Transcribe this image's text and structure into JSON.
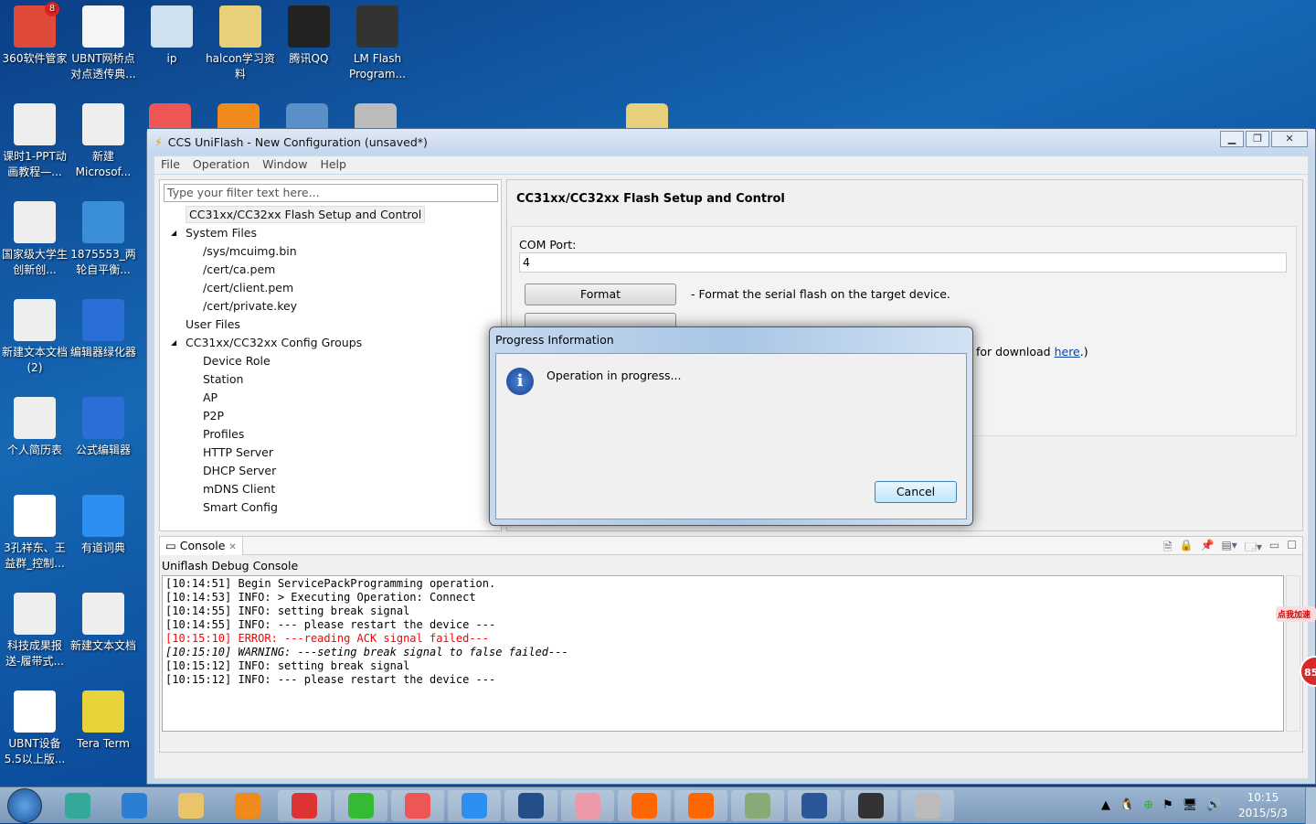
{
  "desktop_icons": [
    {
      "label": "360软件管家",
      "badge": "8",
      "color": "#e04a3a"
    },
    {
      "label": "UBNT网桥点对点透传典...",
      "color": "#f5f5f5"
    },
    {
      "label": "ip",
      "color": "#cfe0f0"
    },
    {
      "label": "halcon学习资料",
      "color": "#e8cf7a"
    },
    {
      "label": "腾讯QQ",
      "color": "#222"
    },
    {
      "label": "LM Flash Program...",
      "color": "#333"
    },
    {
      "label": "课时1-PPT动画教程—...",
      "color": "#eee"
    },
    {
      "label": "新建 Microsof...",
      "color": "#eee"
    },
    {
      "label": "国家级大学生创新创...",
      "color": "#eee"
    },
    {
      "label": "1875553_两轮自平衡...",
      "color": "#3b8fd9"
    },
    {
      "label": "新建文本文档 (2)",
      "color": "#eee"
    },
    {
      "label": "编辑器绿化器",
      "color": "#2a6fd6"
    },
    {
      "label": "个人简历表",
      "color": "#eee"
    },
    {
      "label": "公式编辑器",
      "color": "#2a6fd6"
    },
    {
      "label": "3孔祥东、王益群_控制...",
      "color": "#fff"
    },
    {
      "label": "有道词典",
      "color": "#2d8ff0"
    },
    {
      "label": "科技成果报送-履带式...",
      "color": "#eee"
    },
    {
      "label": "新建文本文档",
      "color": "#eee"
    },
    {
      "label": "UBNT设备5.5以上版...",
      "color": "#fff"
    },
    {
      "label": "Tera Term",
      "color": "#e8d23a"
    }
  ],
  "window": {
    "title": "CCS UniFlash - New Configuration (unsaved*)",
    "menu": [
      "File",
      "Operation",
      "Window",
      "Help"
    ],
    "filter_placeholder": "Type your filter text here...",
    "tree": [
      {
        "label": "CC31xx/CC32xx Flash Setup and Control",
        "level": 0,
        "selected": true
      },
      {
        "label": "System Files",
        "level": 0,
        "expander": "◢"
      },
      {
        "label": "/sys/mcuimg.bin",
        "level": 1
      },
      {
        "label": "/cert/ca.pem",
        "level": 1
      },
      {
        "label": "/cert/client.pem",
        "level": 1
      },
      {
        "label": "/cert/private.key",
        "level": 1
      },
      {
        "label": "User Files",
        "level": 0
      },
      {
        "label": "CC31xx/CC32xx Config Groups",
        "level": 0,
        "expander": "◢"
      },
      {
        "label": "Device Role",
        "level": 1
      },
      {
        "label": "Station",
        "level": 1
      },
      {
        "label": "AP",
        "level": 1
      },
      {
        "label": "P2P",
        "level": 1
      },
      {
        "label": "Profiles",
        "level": 1
      },
      {
        "label": "HTTP Server",
        "level": 1
      },
      {
        "label": "DHCP Server",
        "level": 1
      },
      {
        "label": "mDNS Client",
        "level": 1
      },
      {
        "label": "Smart Config",
        "level": 1
      }
    ],
    "panel_title": "CC31xx/CC32xx Flash Setup and Control",
    "com_port_label": "COM Port:",
    "com_port_value": "4",
    "format_button": "Format",
    "format_desc": "-  Format the serial flash on the target device.",
    "download_text": "for download ",
    "download_link": "here",
    "download_suffix": ".)",
    "console_tab": "Console",
    "console_title": "Uniflash Debug Console",
    "log": [
      {
        "text": "[10:14:51] Begin ServicePackProgramming operation.",
        "type": "info"
      },
      {
        "text": "[10:14:53] INFO: > Executing Operation: Connect",
        "type": "info"
      },
      {
        "text": "[10:14:55] INFO: setting break signal",
        "type": "info"
      },
      {
        "text": "[10:14:55] INFO: --- please restart the device ---",
        "type": "info"
      },
      {
        "text": "[10:15:10] ERROR: ---reading ACK signal failed---",
        "type": "error"
      },
      {
        "text": "[10:15:10] WARNING: ---seting break signal to false failed---",
        "type": "warning"
      },
      {
        "text": "[10:15:12] INFO: setting break signal",
        "type": "info"
      },
      {
        "text": "[10:15:12] INFO: --- please restart the device ---",
        "type": "info"
      }
    ]
  },
  "dialog": {
    "title": "Progress Information",
    "message": "Operation in progress...",
    "cancel": "Cancel"
  },
  "widget": {
    "bubble": "点我加速",
    "number": "85"
  },
  "taskbar": {
    "time": "10:15",
    "date": "2015/5/3"
  },
  "colors": {
    "error": "#ff0000",
    "link": "#0645ad"
  }
}
